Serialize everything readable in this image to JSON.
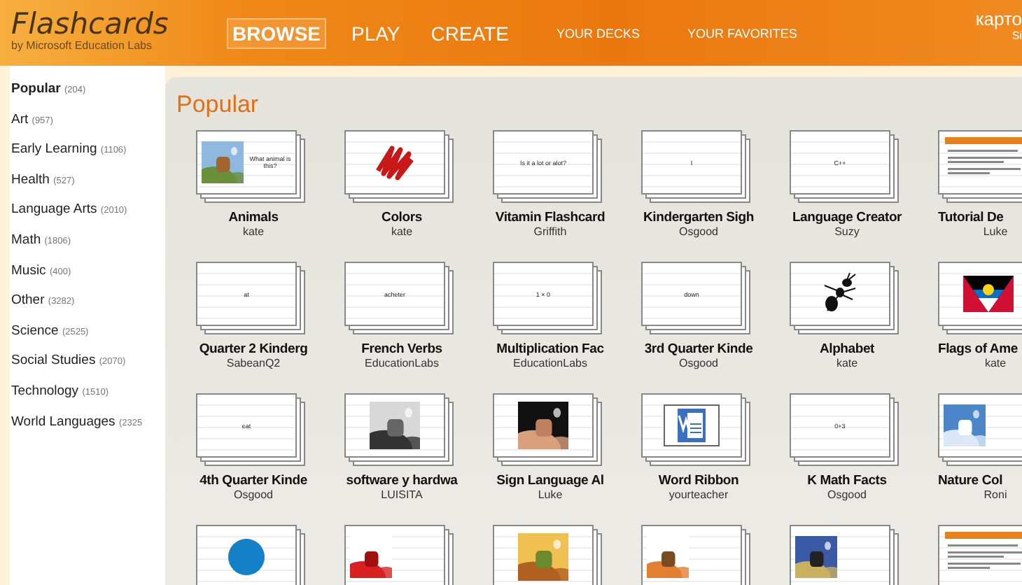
{
  "header": {
    "logo": "Flashcards",
    "subtitle": "by Microsoft Education Labs",
    "nav": [
      {
        "label": "BROWSE",
        "kind": "main",
        "selected": true
      },
      {
        "label": "PLAY",
        "kind": "main",
        "selected": false
      },
      {
        "label": "CREATE",
        "kind": "main",
        "selected": false
      },
      {
        "label": "YOUR DECKS",
        "kind": "sub",
        "selected": false
      },
      {
        "label": "YOUR FAVORITES",
        "kind": "sub",
        "selected": false
      }
    ],
    "user": {
      "name": "карто",
      "line2": "Si"
    }
  },
  "sidebar": {
    "categories": [
      {
        "name": "Popular",
        "count": "(204)",
        "selected": true
      },
      {
        "name": "Art",
        "count": "(957)",
        "selected": false
      },
      {
        "name": "Early Learning",
        "count": "(1106)",
        "selected": false
      },
      {
        "name": "Health",
        "count": "(527)",
        "selected": false
      },
      {
        "name": "Language Arts",
        "count": "(2010)",
        "selected": false
      },
      {
        "name": "Math",
        "count": "(1806)",
        "selected": false
      },
      {
        "name": "Music",
        "count": "(400)",
        "selected": false
      },
      {
        "name": "Other",
        "count": "(3282)",
        "selected": false
      },
      {
        "name": "Science",
        "count": "(2525)",
        "selected": false
      },
      {
        "name": "Social Studies",
        "count": "(2070)",
        "selected": false
      },
      {
        "name": "Technology",
        "count": "(1510)",
        "selected": false
      },
      {
        "name": "World Languages",
        "count": "(2325",
        "selected": false
      }
    ]
  },
  "main": {
    "title": "Popular",
    "decks": [
      {
        "title": "Animals",
        "author": "kate",
        "thumb": {
          "kind": "picture-left",
          "text": "What animal is this?"
        }
      },
      {
        "title": "Colors",
        "author": "kate",
        "thumb": {
          "kind": "scribble"
        }
      },
      {
        "title": "Vitamin Flashcard",
        "author": "Griffith",
        "thumb": {
          "kind": "text",
          "text": "Is it a lot or alot?"
        }
      },
      {
        "title": "Kindergarten Sigh",
        "author": "Osgood",
        "thumb": {
          "kind": "text",
          "text": "I"
        }
      },
      {
        "title": "Language Creator",
        "author": "Suzy",
        "thumb": {
          "kind": "text",
          "text": "C++"
        }
      },
      {
        "title": "Tutorial De",
        "author": "Luke",
        "thumb": {
          "kind": "document"
        }
      },
      {
        "title": "Quarter 2 Kinderg",
        "author": "SabeanQ2",
        "thumb": {
          "kind": "text",
          "text": "at"
        }
      },
      {
        "title": "French Verbs",
        "author": "EducationLabs",
        "thumb": {
          "kind": "text",
          "text": "acheter"
        }
      },
      {
        "title": "Multiplication Fac",
        "author": "EducationLabs",
        "thumb": {
          "kind": "text",
          "text": "1 × 0"
        }
      },
      {
        "title": "3rd Quarter Kinde",
        "author": "Osgood",
        "thumb": {
          "kind": "text",
          "text": "down"
        }
      },
      {
        "title": "Alphabet",
        "author": "kate",
        "thumb": {
          "kind": "ant"
        }
      },
      {
        "title": "Flags of Ame",
        "author": "kate",
        "thumb": {
          "kind": "flag"
        }
      },
      {
        "title": "4th Quarter Kinde",
        "author": "Osgood",
        "thumb": {
          "kind": "text",
          "text": "eat"
        }
      },
      {
        "title": "software y hardwa",
        "author": "LUISITA",
        "thumb": {
          "kind": "picture"
        }
      },
      {
        "title": "Sign Language Al",
        "author": "Luke",
        "thumb": {
          "kind": "picture"
        }
      },
      {
        "title": "Word Ribbon",
        "author": "yourteacher",
        "thumb": {
          "kind": "word-logo"
        }
      },
      {
        "title": "K Math Facts",
        "author": "Osgood",
        "thumb": {
          "kind": "text",
          "text": "0+3"
        }
      },
      {
        "title": "Nature Col",
        "author": "Roni",
        "thumb": {
          "kind": "picture-left"
        }
      },
      {
        "thumb": {
          "kind": "disc"
        }
      },
      {
        "thumb": {
          "kind": "picture-left"
        }
      },
      {
        "thumb": {
          "kind": "picture"
        }
      },
      {
        "thumb": {
          "kind": "picture-left"
        }
      },
      {
        "thumb": {
          "kind": "picture-left"
        }
      },
      {
        "thumb": {
          "kind": "document"
        }
      }
    ]
  }
}
